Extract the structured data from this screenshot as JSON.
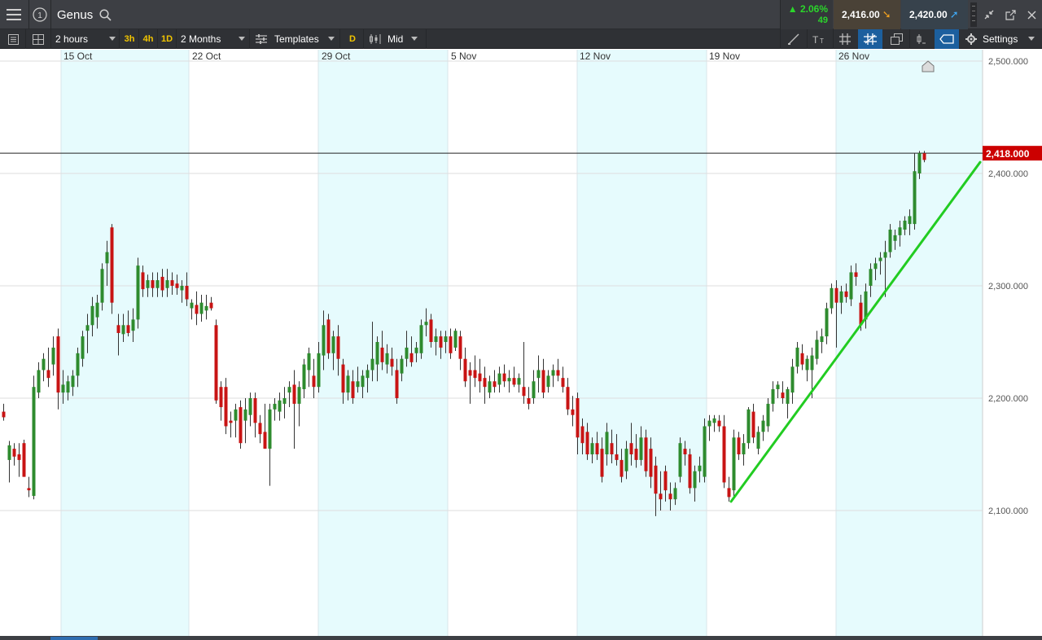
{
  "header": {
    "instrument": "Genus",
    "change_pct": "2.06%",
    "change_pts": "49",
    "sell_price": "2,416.00",
    "buy_price": "2,420.00",
    "info_icon": "1"
  },
  "toolbar": {
    "interval": "2 hours",
    "quick_intervals": [
      "3h",
      "4h",
      "1D"
    ],
    "range": "2 Months",
    "templates_label": "Templates",
    "d_label": "D",
    "price_type": "Mid",
    "settings_label": "Settings"
  },
  "chart_data": {
    "type": "candlestick",
    "x_tick_labels": [
      "15 Oct",
      "22 Oct",
      "29 Oct",
      "5 Nov",
      "12 Nov",
      "19 Nov",
      "26 Nov"
    ],
    "y_tick_labels": [
      "2,500.000",
      "2,400.000",
      "2,300.000",
      "2,200.000",
      "2,100.000"
    ],
    "y_ticks": [
      2500,
      2400,
      2300,
      2200,
      2100
    ],
    "ylim": [
      2030,
      2505
    ],
    "current_price_label": "2,418.000",
    "current_price": 2418,
    "trendline": {
      "from": [
        898,
        2108
      ],
      "to": [
        1204,
        2410
      ],
      "color": "#22cc22"
    },
    "colors": {
      "up": "#2e8b2e",
      "down": "#c81414",
      "weekend_shade": "#e6fbfd",
      "price_tag": "#cc0000"
    },
    "candles": [
      [
        4,
        2188,
        2195,
        2180,
        2183
      ],
      [
        11,
        2145,
        2162,
        2125,
        2158
      ],
      [
        17,
        2155,
        2160,
        2140,
        2148
      ],
      [
        23,
        2150,
        2160,
        2130,
        2145
      ],
      [
        29,
        2160,
        2163,
        2130,
        2130
      ],
      [
        35,
        2120,
        2130,
        2112,
        2118
      ],
      [
        41,
        2113,
        2220,
        2110,
        2210
      ],
      [
        47,
        2205,
        2232,
        2200,
        2225
      ],
      [
        53,
        2225,
        2240,
        2215,
        2235
      ],
      [
        59,
        2225,
        2245,
        2210,
        2218
      ],
      [
        65,
        2230,
        2255,
        2220,
        2245
      ],
      [
        71,
        2255,
        2262,
        2190,
        2205
      ],
      [
        77,
        2205,
        2225,
        2195,
        2212
      ],
      [
        83,
        2205,
        2220,
        2198,
        2215
      ],
      [
        89,
        2210,
        2225,
        2202,
        2220
      ],
      [
        95,
        2220,
        2245,
        2210,
        2240
      ],
      [
        101,
        2235,
        2260,
        2228,
        2255
      ],
      [
        107,
        2260,
        2275,
        2240,
        2265
      ],
      [
        113,
        2265,
        2290,
        2255,
        2282
      ],
      [
        119,
        2272,
        2292,
        2262,
        2285
      ],
      [
        125,
        2285,
        2320,
        2278,
        2315
      ],
      [
        131,
        2320,
        2340,
        2300,
        2330
      ],
      [
        137,
        2352,
        2355,
        2275,
        2285
      ],
      [
        145,
        2265,
        2275,
        2238,
        2258
      ],
      [
        151,
        2257,
        2275,
        2250,
        2265
      ],
      [
        157,
        2265,
        2278,
        2255,
        2258
      ],
      [
        163,
        2260,
        2280,
        2250,
        2270
      ],
      [
        169,
        2270,
        2325,
        2262,
        2318
      ],
      [
        175,
        2312,
        2318,
        2290,
        2297
      ],
      [
        181,
        2298,
        2310,
        2290,
        2305
      ],
      [
        187,
        2305,
        2312,
        2290,
        2298
      ],
      [
        193,
        2298,
        2312,
        2290,
        2305
      ],
      [
        199,
        2308,
        2315,
        2290,
        2296
      ],
      [
        205,
        2298,
        2315,
        2290,
        2305
      ],
      [
        211,
        2305,
        2312,
        2292,
        2300
      ],
      [
        217,
        2302,
        2310,
        2292,
        2298
      ],
      [
        223,
        2296,
        2305,
        2285,
        2300
      ],
      [
        229,
        2300,
        2312,
        2282,
        2288
      ],
      [
        235,
        2280,
        2288,
        2270,
        2285
      ],
      [
        241,
        2283,
        2295,
        2265,
        2275
      ],
      [
        247,
        2275,
        2292,
        2268,
        2285
      ],
      [
        253,
        2278,
        2292,
        2270,
        2282
      ],
      [
        259,
        2285,
        2290,
        2278,
        2280
      ],
      [
        265,
        2265,
        2270,
        2195,
        2198
      ],
      [
        271,
        2210,
        2215,
        2180,
        2192
      ],
      [
        277,
        2210,
        2218,
        2168,
        2175
      ],
      [
        283,
        2180,
        2188,
        2165,
        2178
      ],
      [
        289,
        2180,
        2195,
        2165,
        2190
      ],
      [
        295,
        2192,
        2198,
        2155,
        2160
      ],
      [
        301,
        2180,
        2200,
        2160,
        2190
      ],
      [
        307,
        2185,
        2205,
        2175,
        2200
      ],
      [
        313,
        2200,
        2205,
        2165,
        2178
      ],
      [
        319,
        2178,
        2185,
        2160,
        2168
      ],
      [
        325,
        2170,
        2195,
        2155,
        2155
      ],
      [
        331,
        2155,
        2195,
        2122,
        2190
      ],
      [
        337,
        2190,
        2200,
        2180,
        2195
      ],
      [
        343,
        2188,
        2205,
        2180,
        2198
      ],
      [
        349,
        2195,
        2210,
        2182,
        2200
      ],
      [
        355,
        2205,
        2215,
        2192,
        2210
      ],
      [
        361,
        2212,
        2225,
        2155,
        2195
      ],
      [
        367,
        2195,
        2215,
        2175,
        2210
      ],
      [
        373,
        2208,
        2235,
        2200,
        2230
      ],
      [
        379,
        2225,
        2245,
        2210,
        2240
      ],
      [
        385,
        2220,
        2235,
        2200,
        2210
      ],
      [
        391,
        2210,
        2250,
        2205,
        2240
      ],
      [
        397,
        2238,
        2278,
        2225,
        2265
      ],
      [
        403,
        2270,
        2275,
        2235,
        2240
      ],
      [
        409,
        2240,
        2260,
        2225,
        2255
      ],
      [
        415,
        2255,
        2265,
        2220,
        2235
      ],
      [
        421,
        2230,
        2235,
        2195,
        2205
      ],
      [
        427,
        2205,
        2225,
        2198,
        2220
      ],
      [
        433,
        2215,
        2225,
        2195,
        2200
      ],
      [
        439,
        2210,
        2228,
        2205,
        2215
      ],
      [
        445,
        2210,
        2225,
        2200,
        2220
      ],
      [
        451,
        2218,
        2230,
        2205,
        2225
      ],
      [
        457,
        2225,
        2268,
        2215,
        2235
      ],
      [
        463,
        2230,
        2255,
        2215,
        2250
      ],
      [
        469,
        2245,
        2260,
        2225,
        2232
      ],
      [
        475,
        2230,
        2248,
        2222,
        2240
      ],
      [
        481,
        2235,
        2245,
        2220,
        2228
      ],
      [
        487,
        2225,
        2235,
        2195,
        2200
      ],
      [
        493,
        2222,
        2238,
        2215,
        2235
      ],
      [
        499,
        2235,
        2260,
        2228,
        2245
      ],
      [
        505,
        2240,
        2255,
        2228,
        2232
      ],
      [
        511,
        2240,
        2250,
        2232,
        2245
      ],
      [
        517,
        2240,
        2270,
        2235,
        2265
      ],
      [
        523,
        2265,
        2280,
        2255,
        2268
      ],
      [
        529,
        2270,
        2275,
        2245,
        2250
      ],
      [
        535,
        2250,
        2262,
        2238,
        2255
      ],
      [
        541,
        2255,
        2260,
        2235,
        2245
      ],
      [
        547,
        2250,
        2260,
        2240,
        2255
      ],
      [
        553,
        2255,
        2262,
        2235,
        2240
      ],
      [
        559,
        2245,
        2262,
        2242,
        2260
      ],
      [
        565,
        2255,
        2260,
        2225,
        2235
      ],
      [
        571,
        2235,
        2245,
        2210,
        2215
      ],
      [
        577,
        2225,
        2232,
        2195,
        2220
      ],
      [
        583,
        2225,
        2238,
        2210,
        2218
      ],
      [
        589,
        2222,
        2235,
        2205,
        2215
      ],
      [
        595,
        2218,
        2228,
        2195,
        2210
      ],
      [
        601,
        2205,
        2220,
        2200,
        2215
      ],
      [
        607,
        2215,
        2225,
        2205,
        2210
      ],
      [
        613,
        2212,
        2228,
        2205,
        2222
      ],
      [
        619,
        2222,
        2230,
        2210,
        2215
      ],
      [
        625,
        2215,
        2225,
        2205,
        2218
      ],
      [
        631,
        2218,
        2228,
        2210,
        2212
      ],
      [
        637,
        2212,
        2222,
        2205,
        2218
      ],
      [
        643,
        2210,
        2250,
        2195,
        2202
      ],
      [
        649,
        2200,
        2210,
        2190,
        2195
      ],
      [
        655,
        2200,
        2225,
        2195,
        2215
      ],
      [
        661,
        2218,
        2238,
        2205,
        2225
      ],
      [
        667,
        2225,
        2235,
        2200,
        2205
      ],
      [
        673,
        2210,
        2225,
        2205,
        2220
      ],
      [
        679,
        2220,
        2230,
        2210,
        2225
      ],
      [
        685,
        2225,
        2235,
        2215,
        2220
      ],
      [
        691,
        2218,
        2228,
        2205,
        2210
      ],
      [
        697,
        2210,
        2218,
        2185,
        2190
      ],
      [
        703,
        2190,
        2202,
        2175,
        2185
      ],
      [
        709,
        2200,
        2205,
        2150,
        2165
      ],
      [
        715,
        2175,
        2182,
        2150,
        2160
      ],
      [
        721,
        2170,
        2178,
        2145,
        2150
      ],
      [
        727,
        2150,
        2165,
        2142,
        2160
      ],
      [
        733,
        2160,
        2170,
        2145,
        2150
      ],
      [
        739,
        2155,
        2165,
        2125,
        2130
      ],
      [
        745,
        2150,
        2178,
        2140,
        2170
      ],
      [
        751,
        2160,
        2172,
        2142,
        2150
      ],
      [
        757,
        2150,
        2168,
        2140,
        2145
      ],
      [
        763,
        2145,
        2155,
        2125,
        2130
      ],
      [
        769,
        2135,
        2162,
        2128,
        2155
      ],
      [
        775,
        2160,
        2178,
        2140,
        2150
      ],
      [
        781,
        2155,
        2168,
        2138,
        2145
      ],
      [
        787,
        2145,
        2175,
        2140,
        2165
      ],
      [
        793,
        2165,
        2172,
        2130,
        2135
      ],
      [
        799,
        2155,
        2165,
        2120,
        2130
      ],
      [
        805,
        2140,
        2148,
        2095,
        2115
      ],
      [
        811,
        2115,
        2135,
        2100,
        2110
      ],
      [
        817,
        2135,
        2140,
        2108,
        2118
      ],
      [
        823,
        2115,
        2125,
        2100,
        2110
      ],
      [
        829,
        2110,
        2125,
        2105,
        2120
      ],
      [
        835,
        2130,
        2165,
        2125,
        2160
      ],
      [
        841,
        2155,
        2162,
        2140,
        2150
      ],
      [
        847,
        2150,
        2155,
        2115,
        2120
      ],
      [
        853,
        2120,
        2140,
        2108,
        2135
      ],
      [
        859,
        2135,
        2148,
        2125,
        2140
      ],
      [
        865,
        2130,
        2182,
        2125,
        2175
      ],
      [
        871,
        2175,
        2185,
        2162,
        2180
      ],
      [
        877,
        2178,
        2185,
        2170,
        2182
      ],
      [
        883,
        2180,
        2185,
        2170,
        2175
      ],
      [
        889,
        2175,
        2185,
        2120,
        2125
      ],
      [
        895,
        2120,
        2130,
        2108,
        2112
      ],
      [
        901,
        2118,
        2172,
        2110,
        2165
      ],
      [
        907,
        2165,
        2170,
        2145,
        2150
      ],
      [
        913,
        2150,
        2168,
        2140,
        2160
      ],
      [
        919,
        2160,
        2192,
        2155,
        2190
      ],
      [
        925,
        2188,
        2195,
        2160,
        2165
      ],
      [
        931,
        2155,
        2175,
        2150,
        2170
      ],
      [
        937,
        2170,
        2185,
        2162,
        2180
      ],
      [
        943,
        2175,
        2200,
        2170,
        2195
      ],
      [
        949,
        2195,
        2215,
        2188,
        2208
      ],
      [
        955,
        2208,
        2215,
        2200,
        2212
      ],
      [
        961,
        2205,
        2215,
        2195,
        2200
      ],
      [
        967,
        2195,
        2210,
        2182,
        2208
      ],
      [
        973,
        2205,
        2235,
        2195,
        2228
      ],
      [
        979,
        2228,
        2250,
        2222,
        2245
      ],
      [
        985,
        2240,
        2248,
        2225,
        2230
      ],
      [
        991,
        2225,
        2238,
        2215,
        2235
      ],
      [
        997,
        2225,
        2245,
        2200,
        2238
      ],
      [
        1003,
        2235,
        2260,
        2230,
        2252
      ],
      [
        1009,
        2250,
        2262,
        2240,
        2255
      ],
      [
        1015,
        2255,
        2285,
        2248,
        2280
      ],
      [
        1021,
        2280,
        2302,
        2275,
        2298
      ],
      [
        1027,
        2298,
        2305,
        2245,
        2285
      ],
      [
        1033,
        2285,
        2300,
        2275,
        2295
      ],
      [
        1039,
        2295,
        2302,
        2285,
        2290
      ],
      [
        1045,
        2288,
        2318,
        2282,
        2312
      ],
      [
        1051,
        2312,
        2320,
        2300,
        2308
      ],
      [
        1057,
        2285,
        2292,
        2260,
        2265
      ],
      [
        1063,
        2270,
        2302,
        2262,
        2295
      ],
      [
        1069,
        2300,
        2320,
        2290,
        2315
      ],
      [
        1075,
        2315,
        2325,
        2305,
        2320
      ],
      [
        1081,
        2322,
        2330,
        2310,
        2325
      ],
      [
        1087,
        2325,
        2340,
        2290,
        2330
      ],
      [
        1093,
        2330,
        2355,
        2325,
        2350
      ],
      [
        1099,
        2340,
        2350,
        2332,
        2345
      ],
      [
        1105,
        2345,
        2358,
        2335,
        2352
      ],
      [
        1111,
        2350,
        2362,
        2345,
        2358
      ],
      [
        1117,
        2355,
        2368,
        2345,
        2362
      ],
      [
        1123,
        2355,
        2418,
        2350,
        2402
      ],
      [
        1129,
        2400,
        2420,
        2395,
        2418
      ],
      [
        1135,
        2418,
        2420,
        2410,
        2412
      ]
    ]
  }
}
